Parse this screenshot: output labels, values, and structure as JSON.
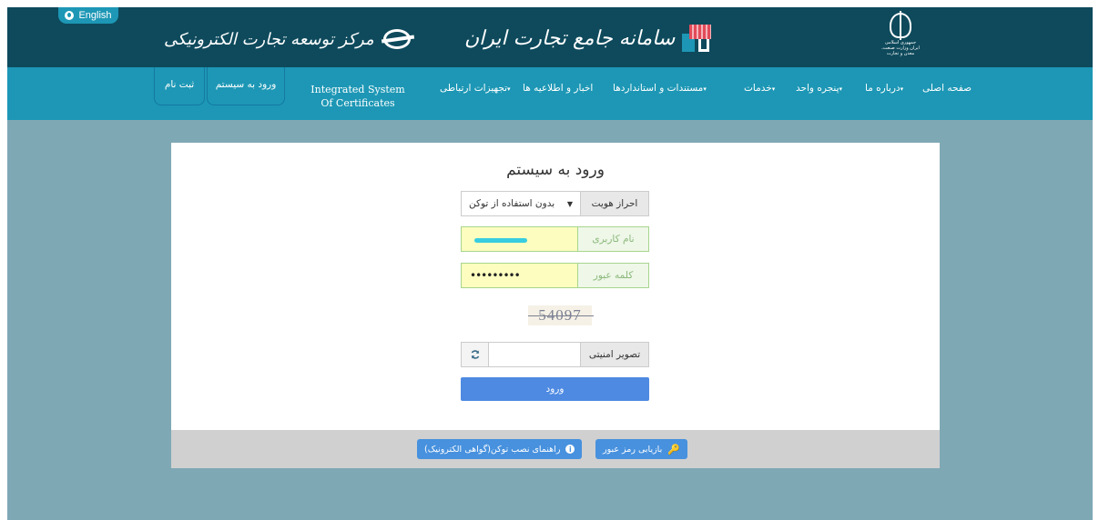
{
  "header": {
    "language_button": "English",
    "brand_left": "مرکز توسعه تجارت الکترونیکی",
    "brand_center": "سامانه جامع تجارت ایران",
    "emblem_caption": "جمهوری اسلامی ایران وزارت صنعت، معدن و تجارت"
  },
  "nav": {
    "items": [
      {
        "label": "صفحه اصلی"
      },
      {
        "label": "درباره ما",
        "caret": "▾"
      },
      {
        "label": "پنجره واحد",
        "caret": "▾"
      },
      {
        "label": "خدمات",
        "caret": "▾"
      },
      {
        "label": "مستندات و استانداردها",
        "caret": "▾"
      },
      {
        "label": "اخبار و اطلاعیه ها"
      },
      {
        "label": "تجهیزات ارتباطی",
        "caret": "▾"
      }
    ],
    "integrated_system": "Integrated System Of Certificates",
    "login_button": "ورود به سیستم",
    "register_button": "ثبت نام"
  },
  "login": {
    "title": "ورود به سیستم",
    "auth_label": "احراز هویت",
    "auth_selected": "بدون استفاده از توکن",
    "username_label": "نام کاربری",
    "password_label": "کلمه عبور",
    "password_value": "•••••••••",
    "captcha_text": "54097",
    "captcha_label": "تصویر امنیتی",
    "captcha_value": "",
    "submit_label": "ورود"
  },
  "footer": {
    "recover_password": "بازیابی رمز عبور",
    "token_guide": "راهنمای نصب توکن(گواهی الکترونیک)"
  },
  "icons": {
    "language": "globe-icon",
    "refresh": "refresh-icon",
    "key": "key-icon",
    "info": "info-icon"
  },
  "colors": {
    "topbar": "#0e4a5c",
    "navbar": "#1d97b5",
    "background": "#7fa8b5",
    "submit": "#4e8ae2",
    "autofill": "#fcfdbf"
  }
}
